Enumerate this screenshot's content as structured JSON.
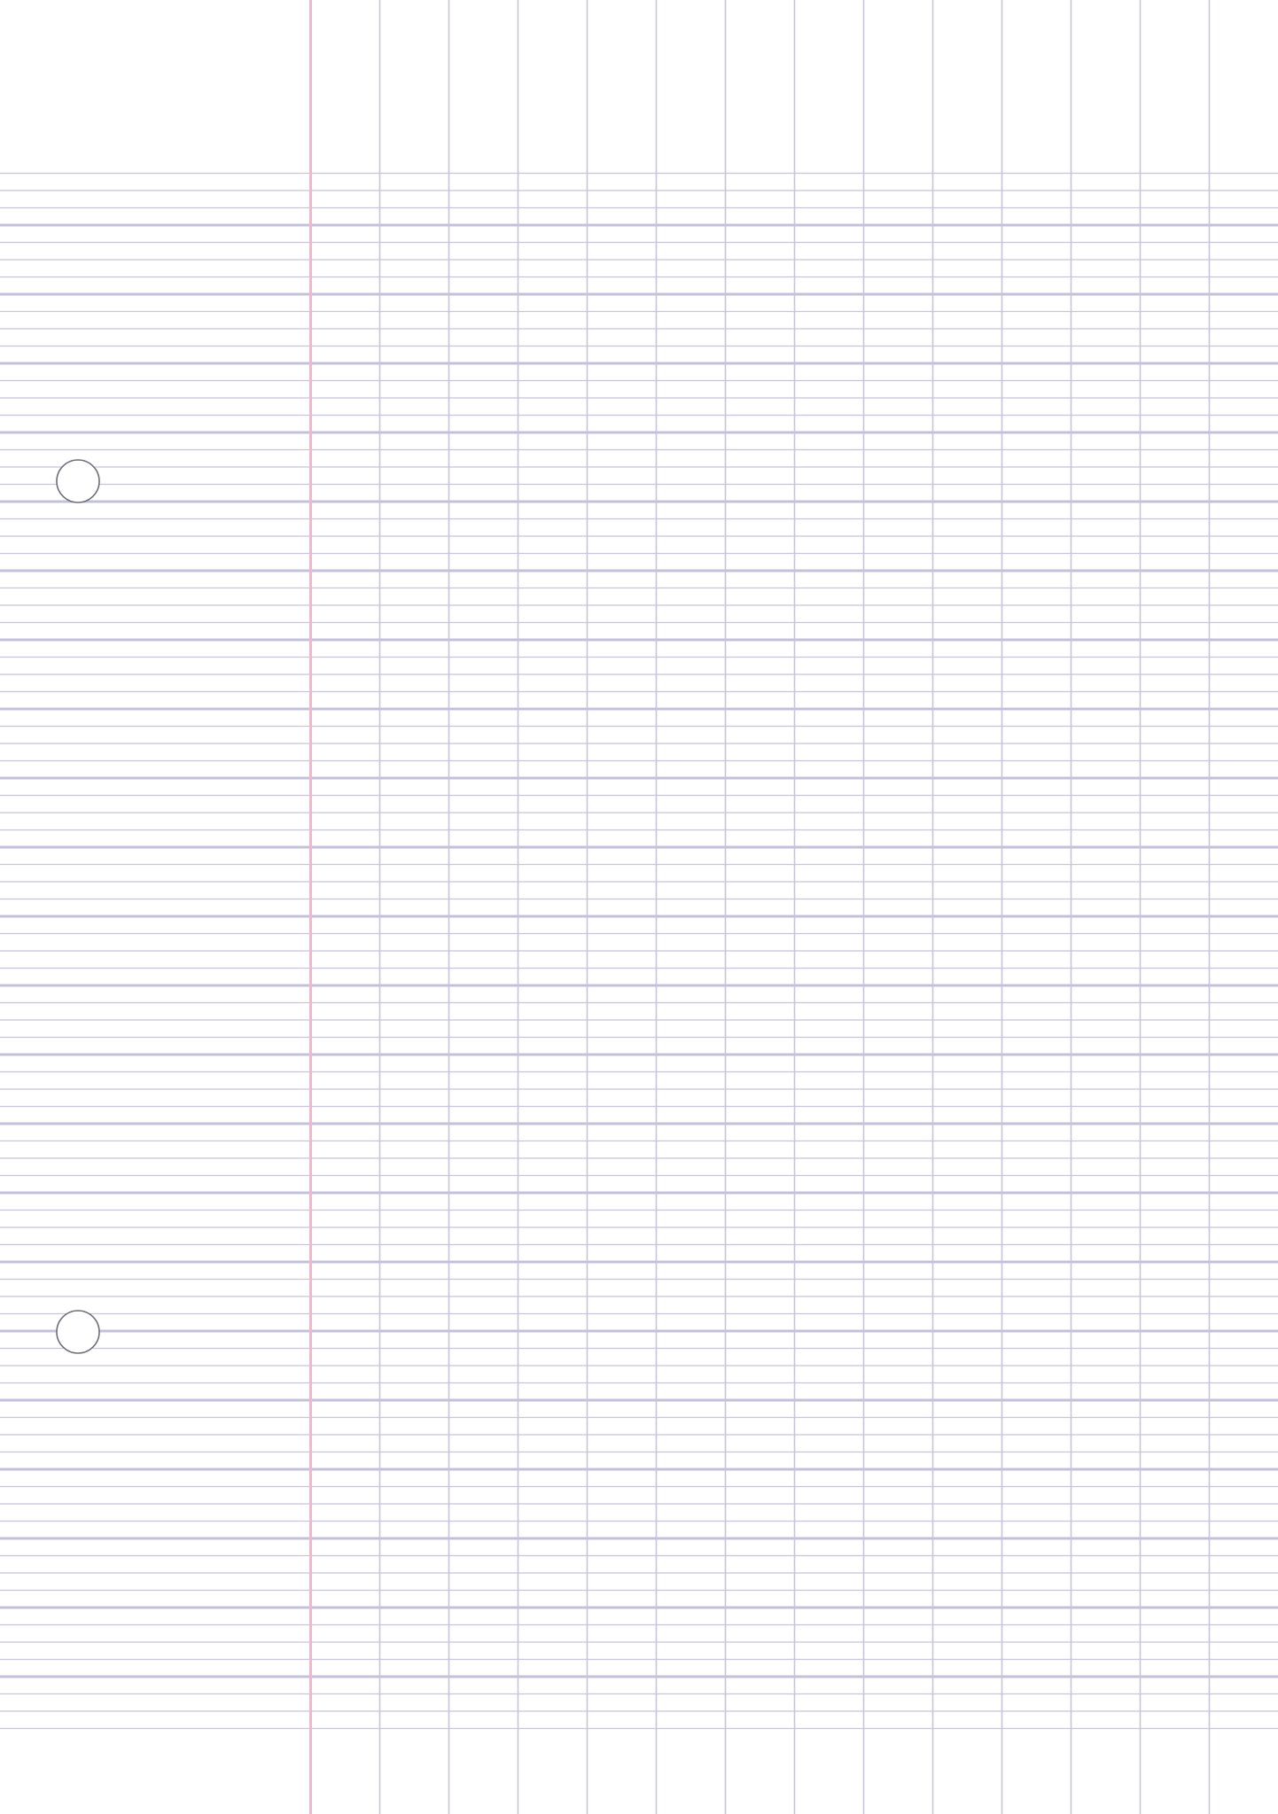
{
  "page": {
    "kind": "blank ruled paper (Seyes grid)",
    "background": "#ffffff"
  },
  "colors": {
    "ruling_line": "#c7c4dc",
    "major_ruling_line": "#c3c0da",
    "margin_line": "#f4b6cc",
    "hole_outline": "#6e6e78"
  },
  "icons": {
    "punch_holes": [
      "punch-hole-icon",
      "punch-hole-icon"
    ]
  }
}
